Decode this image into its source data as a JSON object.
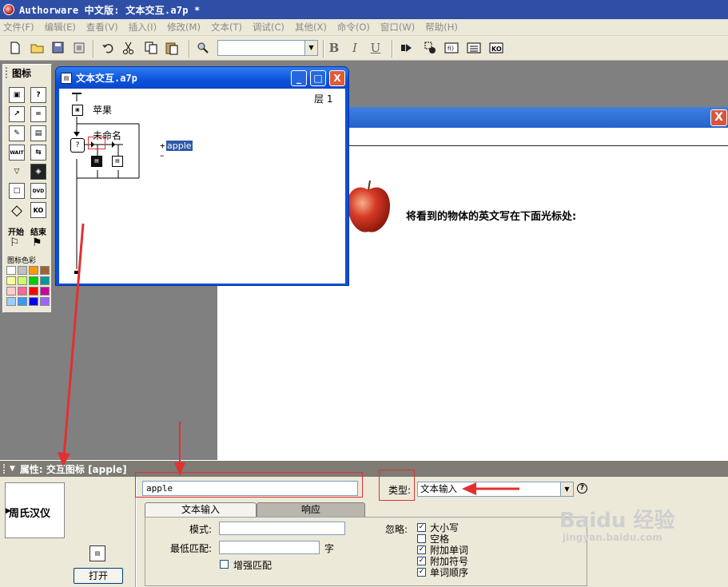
{
  "app": {
    "title": "Authorware 中文版: 文本交互.a7p *"
  },
  "menu": [
    "文件(F)",
    "编辑(E)",
    "查看(V)",
    "插入(I)",
    "修改(M)",
    "文本(T)",
    "调试(C)",
    "其他(X)",
    "命令(O)",
    "窗口(W)",
    "帮助(H)"
  ],
  "toolbar": {
    "font_value": "",
    "bold": "B",
    "italic": "I",
    "underline": "U"
  },
  "palette": {
    "title": "图标",
    "wait_label": "WAIT",
    "dvd_label": "DVD",
    "ko_label": "KO",
    "start_label": "开始",
    "end_label": "结束",
    "color_label": "图标色彩",
    "colors": [
      "#ffffff",
      "#c0c0c0",
      "#ff9900",
      "#996633",
      "#ffff99",
      "#ccff66",
      "#00cc00",
      "#009999",
      "#ffcccc",
      "#ff6699",
      "#ff0000",
      "#cc0099",
      "#99ccff",
      "#3399ff",
      "#0000ff",
      "#9966ff"
    ]
  },
  "flow_window": {
    "title": "文本交互.a7p",
    "level": "层 1",
    "icon_apple": "苹果",
    "icon_unnamed": "未命名",
    "response_label": "apple",
    "minimize": "_",
    "maximize": "□",
    "close": "X"
  },
  "presentation": {
    "instruction": "将看到的物体的英文写在下面光标处:",
    "close": "X"
  },
  "properties": {
    "header": "属性: 交互图标 [apple]",
    "preview_text": "周氏汉仪",
    "open_button": "打开",
    "title_value": "apple",
    "type_label": "类型:",
    "type_value": "文本输入",
    "help": "?",
    "tabs": [
      "文本输入",
      "响应"
    ],
    "pattern_label": "模式:",
    "pattern_value": "",
    "min_match_label": "最低匹配:",
    "min_match_value": "",
    "min_match_unit": "字",
    "incremental_label": "增强匹配",
    "incremental_checked": false,
    "ignore_label": "忽略:",
    "ignore_options": [
      {
        "label": "大小写",
        "checked": true
      },
      {
        "label": "空格",
        "checked": false
      },
      {
        "label": "附加单词",
        "checked": true
      },
      {
        "label": "附加符号",
        "checked": true
      },
      {
        "label": "单词顺序",
        "checked": true
      }
    ]
  },
  "watermark": {
    "brand": "Baidu 经验",
    "url": "jingyan.baidu.com"
  },
  "colors": {
    "annotation_red": "#e23030",
    "titlebar_blue": "#2f4fa6",
    "xp_blue": "#0a50d8"
  }
}
